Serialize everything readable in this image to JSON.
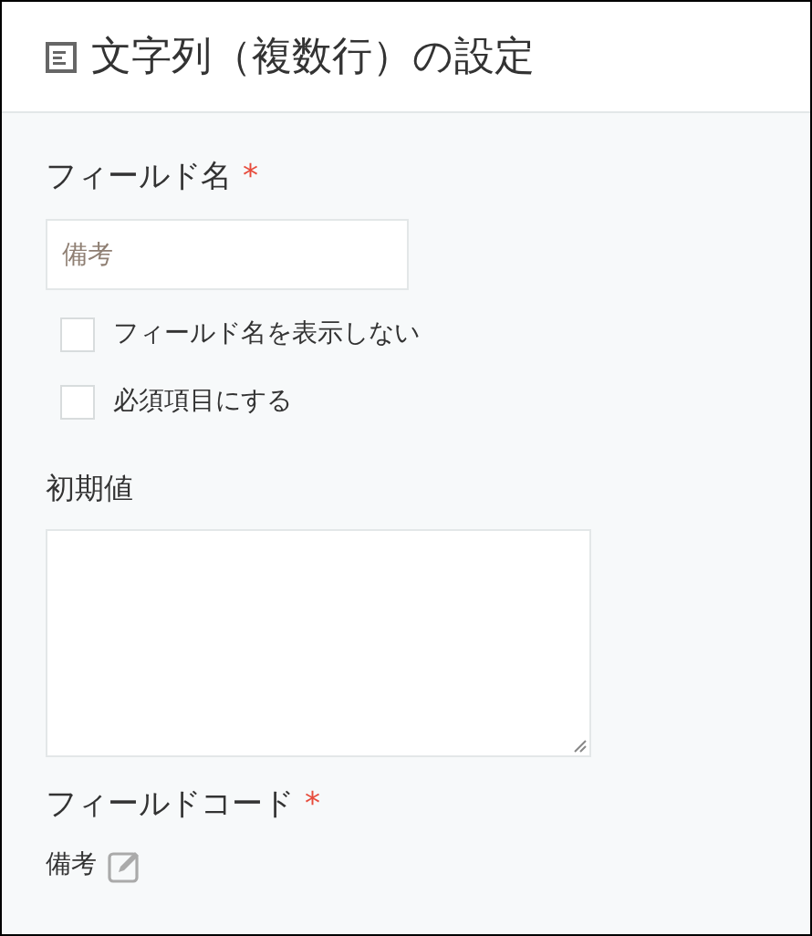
{
  "header": {
    "title": "文字列（複数行）の設定"
  },
  "field_name": {
    "label": "フィールド名",
    "required_mark": "*",
    "placeholder": "備考"
  },
  "options": [
    {
      "label": "フィールド名を表示しない",
      "checked": false
    },
    {
      "label": "必須項目にする",
      "checked": false
    }
  ],
  "default_value": {
    "label": "初期値"
  },
  "field_code": {
    "label": "フィールドコード",
    "required_mark": "*",
    "value": "備考"
  }
}
